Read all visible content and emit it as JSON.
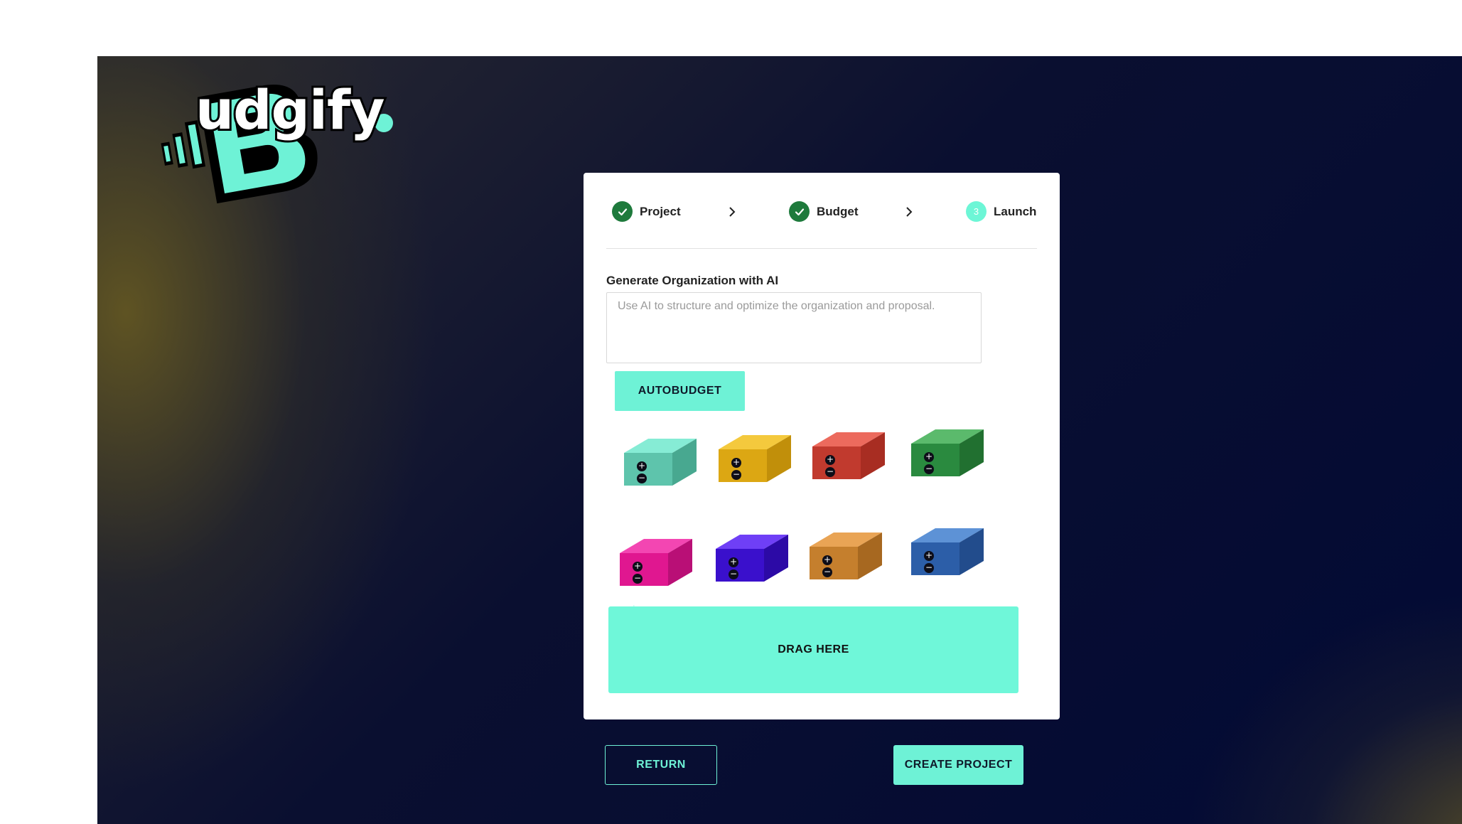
{
  "brand": {
    "name": "Budgify",
    "logo_letter": "B",
    "logo_rest": "udgify",
    "accent": "#6ef2d6"
  },
  "stepper": {
    "steps": [
      {
        "label": "Project",
        "state": "done",
        "icon": "check-icon"
      },
      {
        "label": "Budget",
        "state": "done",
        "icon": "check-icon"
      },
      {
        "label": "Launch",
        "state": "current",
        "number": "3"
      }
    ],
    "separator_icon": "chevron-right-icon"
  },
  "ai": {
    "label": "Generate Organization with AI",
    "placeholder": "Use AI to structure and optimize the organization and proposal.",
    "value": "",
    "button_label": "AUTOBUDGET"
  },
  "blocks": [
    {
      "color": "teal",
      "front": "#5ec4ac",
      "top": "#86ecd5",
      "side": "#48a890"
    },
    {
      "color": "yellow",
      "front": "#dca713",
      "top": "#f4c93d",
      "side": "#c18f0a"
    },
    {
      "color": "red",
      "front": "#c13a2e",
      "top": "#ec6a5d",
      "side": "#a82d22"
    },
    {
      "color": "green",
      "front": "#2a8a3f",
      "top": "#5bba6c",
      "side": "#217030"
    },
    {
      "color": "magenta",
      "front": "#e01790",
      "top": "#f346b2",
      "side": "#b90f76"
    },
    {
      "color": "indigo",
      "front": "#3a10cc",
      "top": "#6f3ff6",
      "side": "#2c0aa6"
    },
    {
      "color": "orange",
      "front": "#c57f2d",
      "top": "#e9a455",
      "side": "#a76820"
    },
    {
      "color": "blue",
      "front": "#2c5ea8",
      "top": "#5d92d6",
      "side": "#224c8c"
    }
  ],
  "block_icons": [
    "plus-icon",
    "minus-icon"
  ],
  "drop_zone": {
    "label": "DRAG HERE"
  },
  "actions": {
    "return_label": "RETURN",
    "create_label": "CREATE PROJECT"
  }
}
